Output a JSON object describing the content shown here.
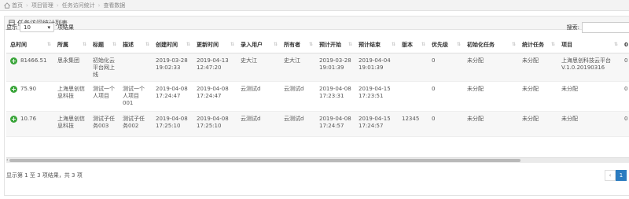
{
  "breadcrumb": [
    "首页",
    "项目管理",
    "任务访问统计",
    "查看数据"
  ],
  "panel_title": "任务访问统计列表",
  "controls": {
    "show_label": "显示",
    "page_size": "10",
    "entries_label": "项结果",
    "search_label": "搜索:",
    "search_value": ""
  },
  "columns": [
    "总时间",
    "所属",
    "标题",
    "描述",
    "创建时间",
    "更新时间",
    "录入用户",
    "所有者",
    "预计开始",
    "预计结束",
    "版本",
    "优先级",
    "初始化任务",
    "统计任务",
    "项目",
    "0"
  ],
  "rows": [
    [
      "81466.51",
      "思永集团",
      "初始化云平台网上线",
      "",
      "2019-03-28 19:02:33",
      "2019-04-13 12:47:20",
      "史大江",
      "史大江",
      "2019-03-28 19:01:39",
      "2019-04-04 19:01:39",
      "",
      "0",
      "未分配",
      "未分配",
      "上海思创科技云平台V.1.0.20190316",
      "0"
    ],
    [
      "75.90",
      "上海思创信息科技",
      "测试一个人项目",
      "测试一个人项目001",
      "2019-04-08 17:24:47",
      "2019-04-08 17:24:47",
      "云测试d",
      "云测试d",
      "2019-04-08 17:23:31",
      "2019-04-15 17:23:51",
      "",
      "0",
      "未分配",
      "未分配",
      "未分配",
      "0"
    ],
    [
      "10.76",
      "上海思创信息科技",
      "测试子任务003",
      "测试子任务002",
      "2019-04-08 17:25:10",
      "2019-04-08 17:25:10",
      "云测试d",
      "云测试d",
      "2019-04-08 17:24:57",
      "2019-04-15 17:24:57",
      "12345",
      "0",
      "未分配",
      "未分配",
      "未分配",
      "0"
    ]
  ],
  "info_text": "显示第 1 至 3 项结果，共 3 项",
  "pager": {
    "prev": "‹",
    "current": "1"
  },
  "colors": {
    "accent": "#2c7cc0",
    "expand": "#3aa53a"
  }
}
